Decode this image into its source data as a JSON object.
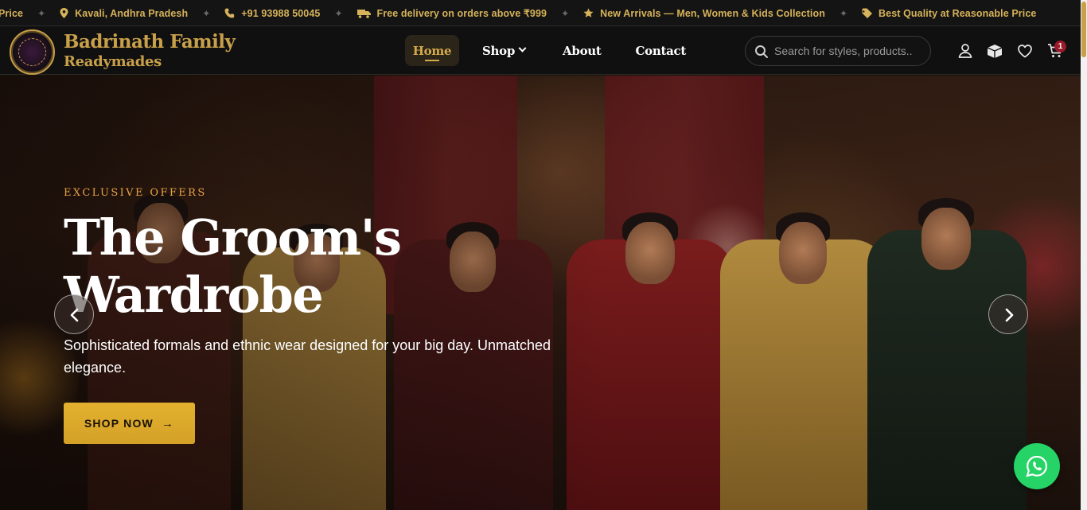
{
  "ticker": {
    "items": [
      {
        "icon": "tag-icon",
        "text": "Price"
      },
      {
        "icon": "location-pin-icon",
        "text": "Kavali, Andhra Pradesh"
      },
      {
        "icon": "phone-icon",
        "text": "+91 93988 50045"
      },
      {
        "icon": "truck-icon",
        "text": "Free delivery on orders above ₹999"
      },
      {
        "icon": "star-icon",
        "text": "New Arrivals — Men, Women & Kids Collection"
      },
      {
        "icon": "tag-icon",
        "text": "Best Quality at Reasonable Price"
      }
    ],
    "separator": "✦"
  },
  "header": {
    "brand_line1": "Badrinath Family",
    "brand_line2": "Readymades",
    "nav": {
      "home": "Home",
      "shop": "Shop",
      "about": "About",
      "contact": "Contact"
    },
    "search_placeholder": "Search for styles, products..",
    "cart_count": "1"
  },
  "hero": {
    "eyebrow": "EXCLUSIVE OFFERS",
    "title": "The Groom's Wardrobe",
    "subtitle": "Sophisticated formals and ethnic wear designed for your big day. Unmatched elegance.",
    "cta": "SHOP NOW",
    "cta_arrow": "→"
  },
  "colors": {
    "accent": "#c9a04a",
    "cta": "#e3b12e",
    "whatsapp": "#25d366",
    "badge": "#9c1b2a"
  }
}
